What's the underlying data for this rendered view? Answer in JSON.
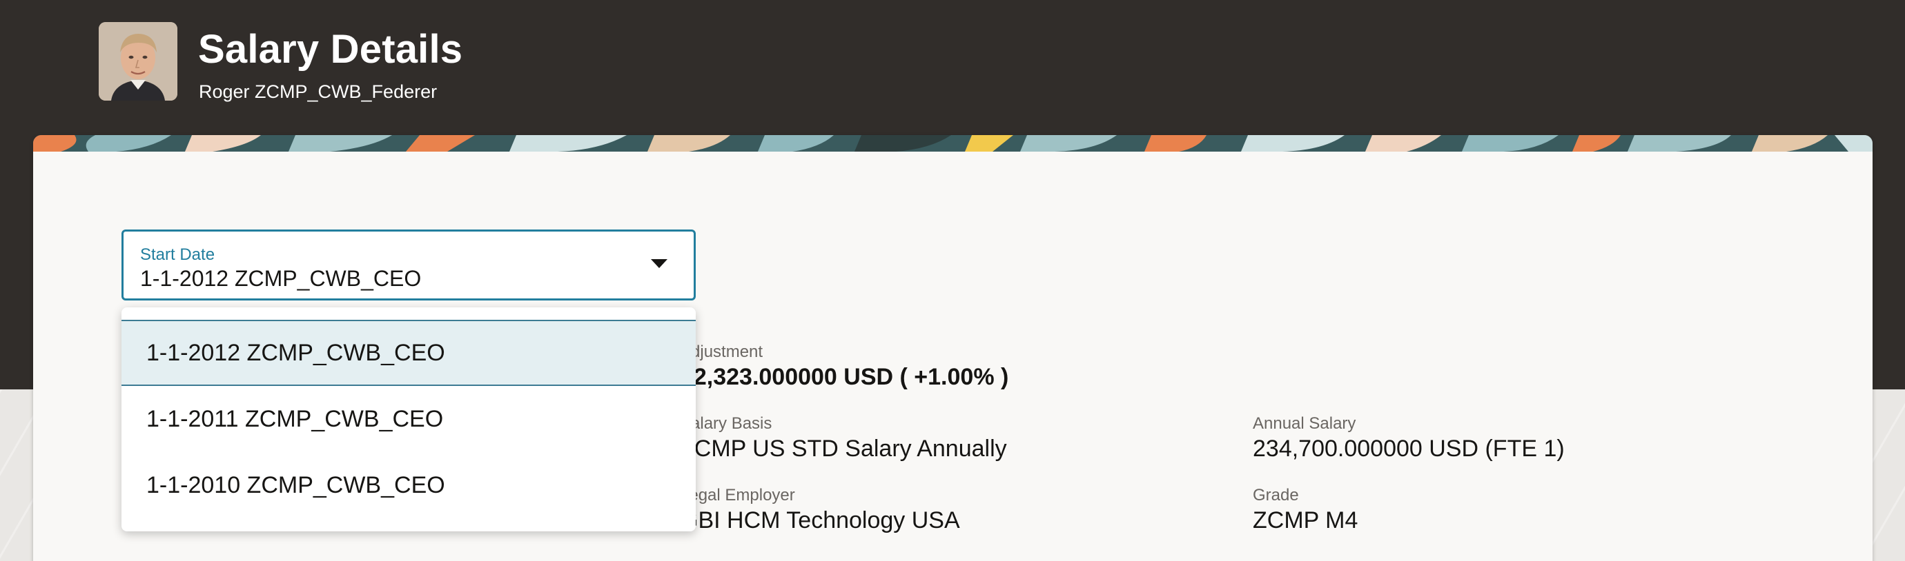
{
  "header": {
    "title": "Salary Details",
    "subtitle": "Roger ZCMP_CWB_Federer",
    "avatar_icon": "person-photo"
  },
  "start_date": {
    "label": "Start Date",
    "selected_value": "1-1-2012 ZCMP_CWB_CEO",
    "options": [
      "1-1-2012 ZCMP_CWB_CEO",
      "1-1-2011 ZCMP_CWB_CEO",
      "1-1-2010 ZCMP_CWB_CEO"
    ]
  },
  "details": {
    "adjustment": {
      "label": "Adjustment",
      "value": "+2,323.000000 USD ( +1.00% )"
    },
    "salary_basis": {
      "label": "Salary Basis",
      "value": "ZCMP US STD Salary Annually"
    },
    "annual_salary": {
      "label": "Annual Salary",
      "value": "234,700.000000 USD (FTE 1)"
    },
    "legal_employer": {
      "label": "Legal Employer",
      "value": "GBI HCM Technology USA"
    },
    "grade": {
      "label": "Grade",
      "value": "ZCMP M4"
    }
  },
  "colors": {
    "header_bg": "#312d2a",
    "accent": "#227e9e",
    "selected_option_bg": "#e4eff2"
  }
}
